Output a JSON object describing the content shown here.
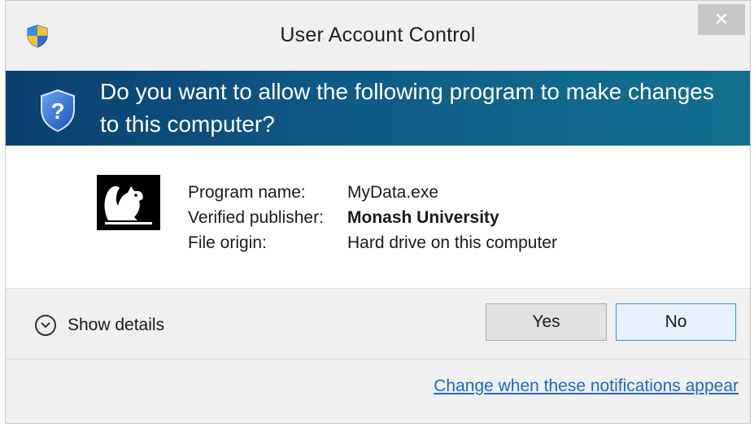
{
  "window": {
    "title": "User Account Control",
    "close_icon": "close-icon"
  },
  "banner": {
    "question": "Do you want to allow the following program to make changes to this computer?",
    "icon": "question-shield-icon"
  },
  "program": {
    "icon": "squirrel-icon",
    "rows": [
      {
        "label": "Program name:",
        "value": "MyData.exe",
        "bold": false
      },
      {
        "label": "Verified publisher:",
        "value": "Monash University",
        "bold": true
      },
      {
        "label": "File origin:",
        "value": "Hard drive on this computer",
        "bold": false
      }
    ]
  },
  "details": {
    "label": "Show details",
    "icon": "chevron-down-icon"
  },
  "buttons": {
    "yes": "Yes",
    "no": "No"
  },
  "footer": {
    "link": "Change when these notifications appear"
  },
  "colors": {
    "banner_start": "#0a3f6e",
    "banner_end": "#13718f",
    "link": "#1e68c5"
  }
}
